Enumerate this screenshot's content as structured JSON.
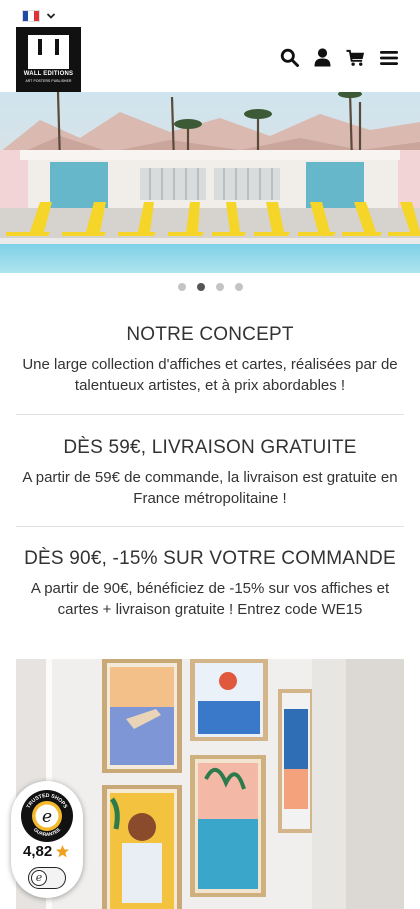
{
  "header": {
    "language": {
      "flag_colors": [
        "#1f4aa8",
        "#ffffff",
        "#e0313a"
      ]
    },
    "logo": {
      "title": "WALL EDITIONS",
      "subtitle": "ART POSTERS PUBLISHER"
    },
    "icons": [
      "search-icon",
      "account-icon",
      "cart-icon",
      "menu-icon"
    ]
  },
  "carousel": {
    "slides": 4,
    "active_index": 1
  },
  "sections": [
    {
      "title": "NOTRE CONCEPT",
      "text": "Une large collection d'affiches et cartes, réalisées par de talentueux artistes, et à prix abordables !"
    },
    {
      "title": "DÈS 59€, LIVRAISON GRATUITE",
      "text": "A partir de 59€ de commande, la livraison est gratuite en France métropolitaine !"
    },
    {
      "title": "DÈS 90€, -15% SUR VOTRE COMMANDE",
      "text": "A partir de 90€, bénéficiez de -15% sur vos affiches et cartes + livraison gratuite ! Entrez code WE15"
    }
  ],
  "trusted_badge": {
    "seal_text": "TRUSTED SHOPS GUARANTEE",
    "rating": "4,82",
    "star_color": "#f0a020"
  },
  "colors": {
    "text": "#333333",
    "dot_active": "#555555",
    "dot_inactive": "#c4c4c4",
    "pool_chairs": "#f5d628"
  }
}
